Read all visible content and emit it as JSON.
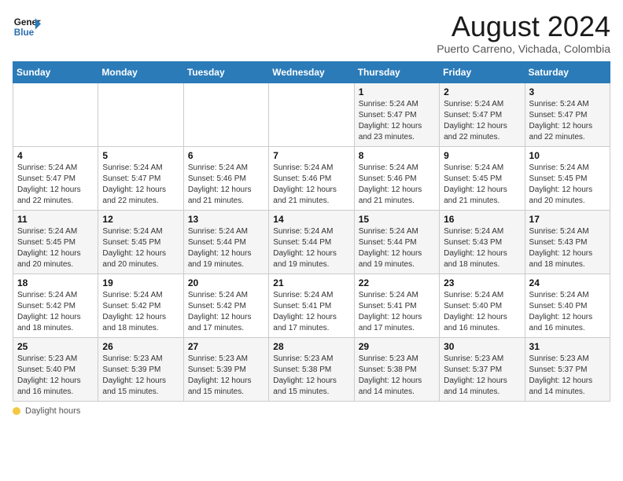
{
  "header": {
    "logo_line1": "General",
    "logo_line2": "Blue",
    "month_title": "August 2024",
    "location": "Puerto Carreno, Vichada, Colombia"
  },
  "days_of_week": [
    "Sunday",
    "Monday",
    "Tuesday",
    "Wednesday",
    "Thursday",
    "Friday",
    "Saturday"
  ],
  "weeks": [
    [
      {
        "day": "",
        "info": ""
      },
      {
        "day": "",
        "info": ""
      },
      {
        "day": "",
        "info": ""
      },
      {
        "day": "",
        "info": ""
      },
      {
        "day": "1",
        "info": "Sunrise: 5:24 AM\nSunset: 5:47 PM\nDaylight: 12 hours\nand 23 minutes."
      },
      {
        "day": "2",
        "info": "Sunrise: 5:24 AM\nSunset: 5:47 PM\nDaylight: 12 hours\nand 22 minutes."
      },
      {
        "day": "3",
        "info": "Sunrise: 5:24 AM\nSunset: 5:47 PM\nDaylight: 12 hours\nand 22 minutes."
      }
    ],
    [
      {
        "day": "4",
        "info": "Sunrise: 5:24 AM\nSunset: 5:47 PM\nDaylight: 12 hours\nand 22 minutes."
      },
      {
        "day": "5",
        "info": "Sunrise: 5:24 AM\nSunset: 5:47 PM\nDaylight: 12 hours\nand 22 minutes."
      },
      {
        "day": "6",
        "info": "Sunrise: 5:24 AM\nSunset: 5:46 PM\nDaylight: 12 hours\nand 21 minutes."
      },
      {
        "day": "7",
        "info": "Sunrise: 5:24 AM\nSunset: 5:46 PM\nDaylight: 12 hours\nand 21 minutes."
      },
      {
        "day": "8",
        "info": "Sunrise: 5:24 AM\nSunset: 5:46 PM\nDaylight: 12 hours\nand 21 minutes."
      },
      {
        "day": "9",
        "info": "Sunrise: 5:24 AM\nSunset: 5:45 PM\nDaylight: 12 hours\nand 21 minutes."
      },
      {
        "day": "10",
        "info": "Sunrise: 5:24 AM\nSunset: 5:45 PM\nDaylight: 12 hours\nand 20 minutes."
      }
    ],
    [
      {
        "day": "11",
        "info": "Sunrise: 5:24 AM\nSunset: 5:45 PM\nDaylight: 12 hours\nand 20 minutes."
      },
      {
        "day": "12",
        "info": "Sunrise: 5:24 AM\nSunset: 5:45 PM\nDaylight: 12 hours\nand 20 minutes."
      },
      {
        "day": "13",
        "info": "Sunrise: 5:24 AM\nSunset: 5:44 PM\nDaylight: 12 hours\nand 19 minutes."
      },
      {
        "day": "14",
        "info": "Sunrise: 5:24 AM\nSunset: 5:44 PM\nDaylight: 12 hours\nand 19 minutes."
      },
      {
        "day": "15",
        "info": "Sunrise: 5:24 AM\nSunset: 5:44 PM\nDaylight: 12 hours\nand 19 minutes."
      },
      {
        "day": "16",
        "info": "Sunrise: 5:24 AM\nSunset: 5:43 PM\nDaylight: 12 hours\nand 18 minutes."
      },
      {
        "day": "17",
        "info": "Sunrise: 5:24 AM\nSunset: 5:43 PM\nDaylight: 12 hours\nand 18 minutes."
      }
    ],
    [
      {
        "day": "18",
        "info": "Sunrise: 5:24 AM\nSunset: 5:42 PM\nDaylight: 12 hours\nand 18 minutes."
      },
      {
        "day": "19",
        "info": "Sunrise: 5:24 AM\nSunset: 5:42 PM\nDaylight: 12 hours\nand 18 minutes."
      },
      {
        "day": "20",
        "info": "Sunrise: 5:24 AM\nSunset: 5:42 PM\nDaylight: 12 hours\nand 17 minutes."
      },
      {
        "day": "21",
        "info": "Sunrise: 5:24 AM\nSunset: 5:41 PM\nDaylight: 12 hours\nand 17 minutes."
      },
      {
        "day": "22",
        "info": "Sunrise: 5:24 AM\nSunset: 5:41 PM\nDaylight: 12 hours\nand 17 minutes."
      },
      {
        "day": "23",
        "info": "Sunrise: 5:24 AM\nSunset: 5:40 PM\nDaylight: 12 hours\nand 16 minutes."
      },
      {
        "day": "24",
        "info": "Sunrise: 5:24 AM\nSunset: 5:40 PM\nDaylight: 12 hours\nand 16 minutes."
      }
    ],
    [
      {
        "day": "25",
        "info": "Sunrise: 5:23 AM\nSunset: 5:40 PM\nDaylight: 12 hours\nand 16 minutes."
      },
      {
        "day": "26",
        "info": "Sunrise: 5:23 AM\nSunset: 5:39 PM\nDaylight: 12 hours\nand 15 minutes."
      },
      {
        "day": "27",
        "info": "Sunrise: 5:23 AM\nSunset: 5:39 PM\nDaylight: 12 hours\nand 15 minutes."
      },
      {
        "day": "28",
        "info": "Sunrise: 5:23 AM\nSunset: 5:38 PM\nDaylight: 12 hours\nand 15 minutes."
      },
      {
        "day": "29",
        "info": "Sunrise: 5:23 AM\nSunset: 5:38 PM\nDaylight: 12 hours\nand 14 minutes."
      },
      {
        "day": "30",
        "info": "Sunrise: 5:23 AM\nSunset: 5:37 PM\nDaylight: 12 hours\nand 14 minutes."
      },
      {
        "day": "31",
        "info": "Sunrise: 5:23 AM\nSunset: 5:37 PM\nDaylight: 12 hours\nand 14 minutes."
      }
    ]
  ],
  "footer": {
    "daylight_label": "Daylight hours"
  }
}
